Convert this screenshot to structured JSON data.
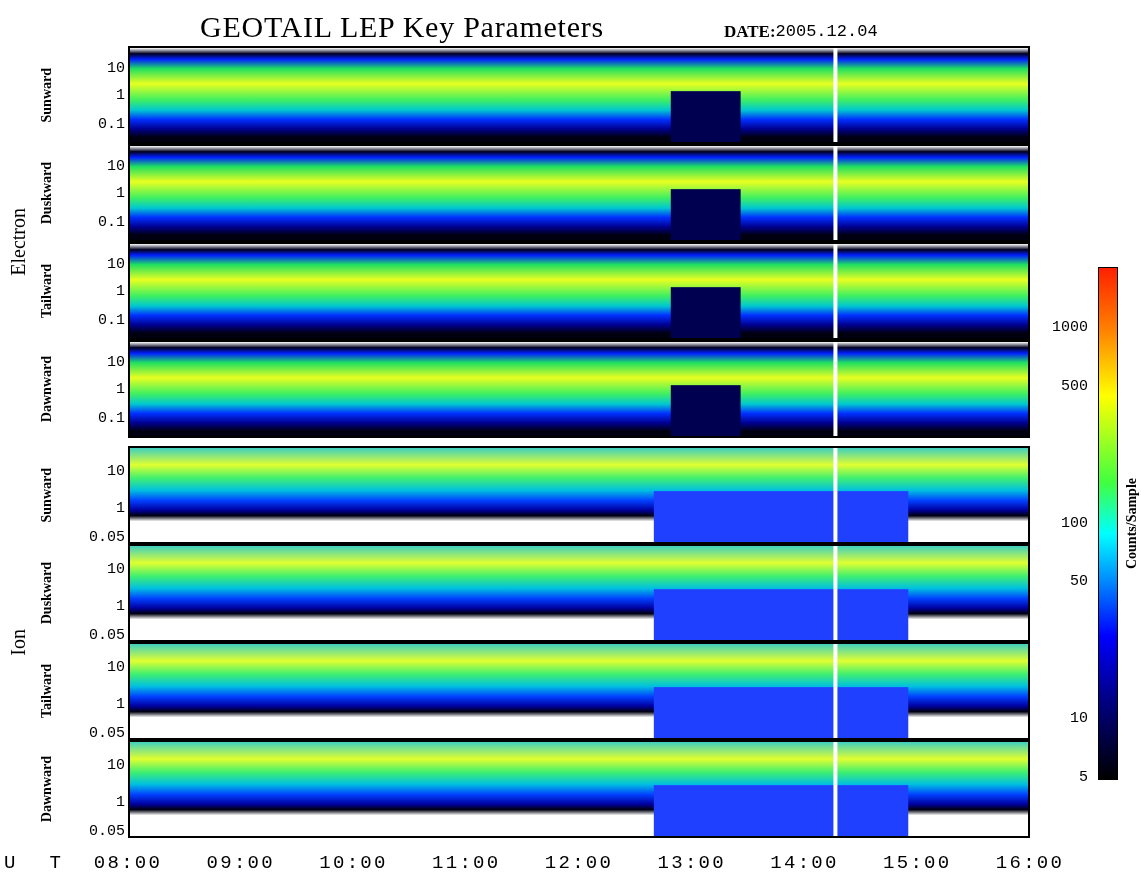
{
  "title": "GEOTAIL LEP Key Parameters",
  "date_label": "DATE:",
  "date_value": "2005.12.04",
  "groups": [
    {
      "label": "Electron",
      "kind": "electron",
      "panels": [
        {
          "label": "Sunward",
          "yticks": [
            "10",
            "1",
            "0.1"
          ]
        },
        {
          "label": "Duskward",
          "yticks": [
            "10",
            "1",
            "0.1"
          ]
        },
        {
          "label": "Tailward",
          "yticks": [
            "10",
            "1",
            "0.1"
          ]
        },
        {
          "label": "Dawnward",
          "yticks": [
            "10",
            "1",
            "0.1"
          ]
        }
      ]
    },
    {
      "label": "Ion",
      "kind": "ion",
      "panels": [
        {
          "label": "Sunward",
          "yticks": [
            "10",
            "1",
            "0.05"
          ]
        },
        {
          "label": "Duskward",
          "yticks": [
            "10",
            "1",
            "0.05"
          ]
        },
        {
          "label": "Tailward",
          "yticks": [
            "10",
            "1",
            "0.05"
          ]
        },
        {
          "label": "Dawnward",
          "yticks": [
            "10",
            "1",
            "0.05"
          ]
        }
      ]
    }
  ],
  "x_axis": {
    "label": "U T",
    "ticks": [
      "08:00",
      "09:00",
      "10:00",
      "11:00",
      "12:00",
      "13:00",
      "14:00",
      "15:00",
      "16:00"
    ]
  },
  "colorbar": {
    "title": "Counts/Sample",
    "ticks": [
      "1000",
      "500",
      "100",
      "50",
      "10",
      "5"
    ]
  }
}
